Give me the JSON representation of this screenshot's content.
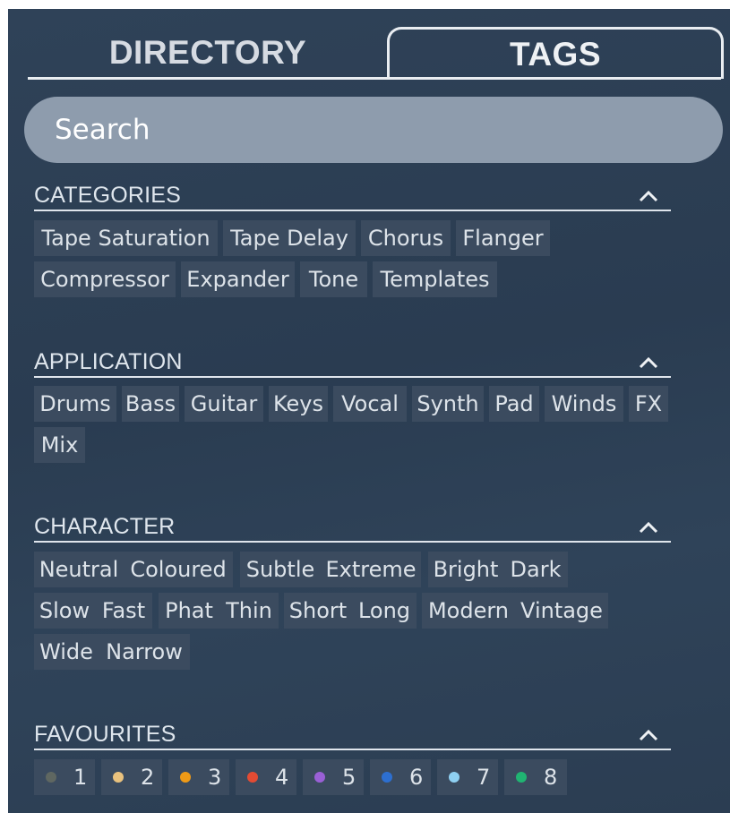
{
  "tabs": {
    "directory": "DIRECTORY",
    "tags": "TAGS"
  },
  "search": {
    "placeholder": "Search"
  },
  "sections": {
    "categories": {
      "title": "CATEGORIES",
      "rows": [
        [
          "Tape Saturation",
          "Tape Delay",
          "Chorus",
          "Flanger"
        ],
        [
          "Compressor",
          "Expander",
          "Tone",
          "Templates"
        ]
      ]
    },
    "application": {
      "title": "APPLICATION",
      "rows": [
        [
          "Drums",
          "Bass",
          "Guitar",
          "Keys",
          "Vocal",
          "Synth",
          "Pad",
          "Winds",
          "FX"
        ],
        [
          "Mix"
        ]
      ]
    },
    "character": {
      "title": "CHARACTER",
      "rows": [
        [
          "Neutral",
          "Coloured",
          "Subtle",
          "Extreme",
          "Bright",
          "Dark"
        ],
        [
          "Slow",
          "Fast",
          "Phat",
          "Thin",
          "Short",
          "Long",
          "Modern",
          "Vintage"
        ],
        [
          "Wide",
          "Narrow"
        ]
      ]
    },
    "favourites": {
      "title": "FAVOURITES",
      "items": [
        {
          "label": "1",
          "color": "#5f6761"
        },
        {
          "label": "2",
          "color": "#e9c27e"
        },
        {
          "label": "3",
          "color": "#ef9a16"
        },
        {
          "label": "4",
          "color": "#e34b33"
        },
        {
          "label": "5",
          "color": "#9a60d6"
        },
        {
          "label": "6",
          "color": "#2d6fd0"
        },
        {
          "label": "7",
          "color": "#8fd0f2"
        },
        {
          "label": "8",
          "color": "#20b472"
        }
      ]
    }
  },
  "icons": {
    "section_toggle": "chevron-up-icon"
  },
  "colors": {
    "chip_bg": "#3b4b5f",
    "panel_bg": "#2d3f54",
    "search_bg": "#8e9cad"
  }
}
